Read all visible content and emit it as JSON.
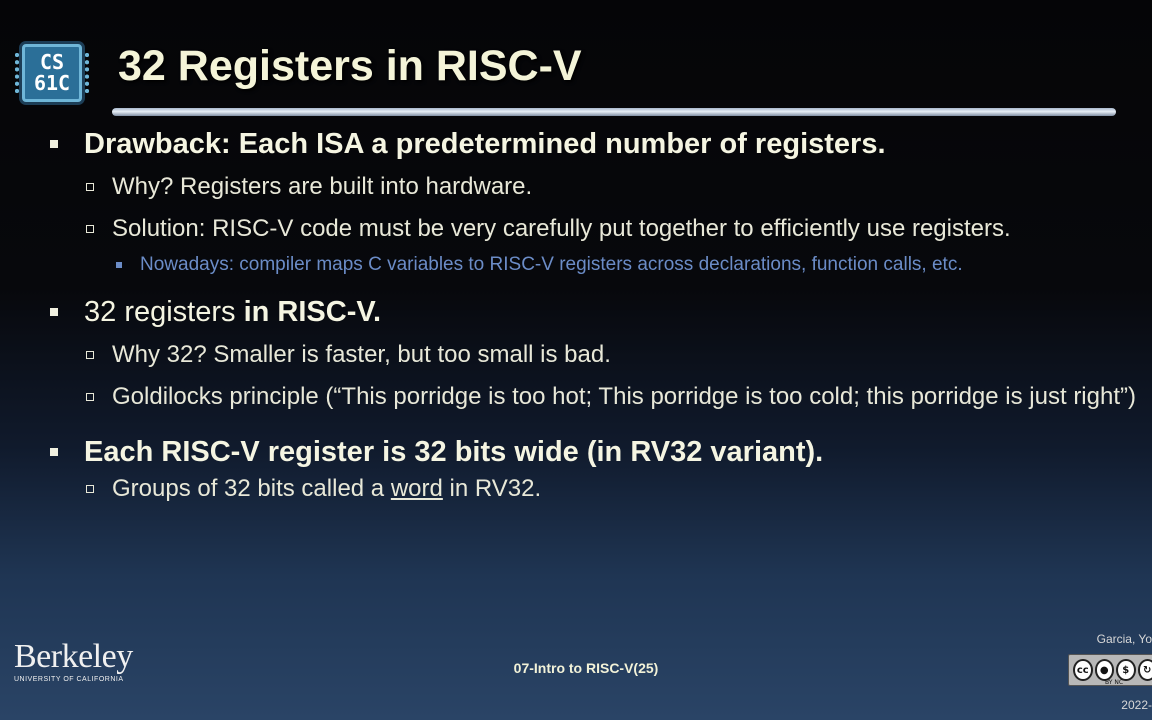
{
  "logo": {
    "line1": "CS",
    "line2": "61C"
  },
  "title": "32 Registers in RISC-V",
  "bullets": {
    "b1": {
      "bold": "Drawback: Each ISA a predetermined number of registers.",
      "sub1": "Why? Registers are built into hardware.",
      "sub2": "Solution: RISC-V code must be very carefully put together to efficiently use registers.",
      "subsub1": "Nowadays: compiler maps C variables to RISC-V registers across declarations, function calls, etc."
    },
    "b2": {
      "normal": "32 registers ",
      "bold": "in RISC-V.",
      "sub1": "Why 32? Smaller is faster, but too small is bad.",
      "sub2": "Goldilocks principle (“This porridge is too hot; This porridge is too cold; this porridge is just right”)"
    },
    "b3": {
      "bold": "Each RISC-V register is 32 bits wide (in RV32 variant).",
      "sub1_pre": "Groups of 32 bits called a ",
      "sub1_word": "word",
      "sub1_post": " in RV32."
    }
  },
  "footer": {
    "university": "Berkeley",
    "university_sub": "UNIVERSITY OF CALIFORNIA",
    "lecture": "07-Intro to RISC-V(25)",
    "credit": "Garcia, Yo",
    "license_icons": [
      "cc-icon",
      "by-icon",
      "nc-icon",
      "sa-icon"
    ],
    "license_tags": "BY   NC",
    "date": "2022-"
  },
  "colors": {
    "title": "#f4f4d8",
    "body_text": "#f5f5e2",
    "subsub_text": "#6b8cc7",
    "logo_bg": "#2b6f98"
  }
}
